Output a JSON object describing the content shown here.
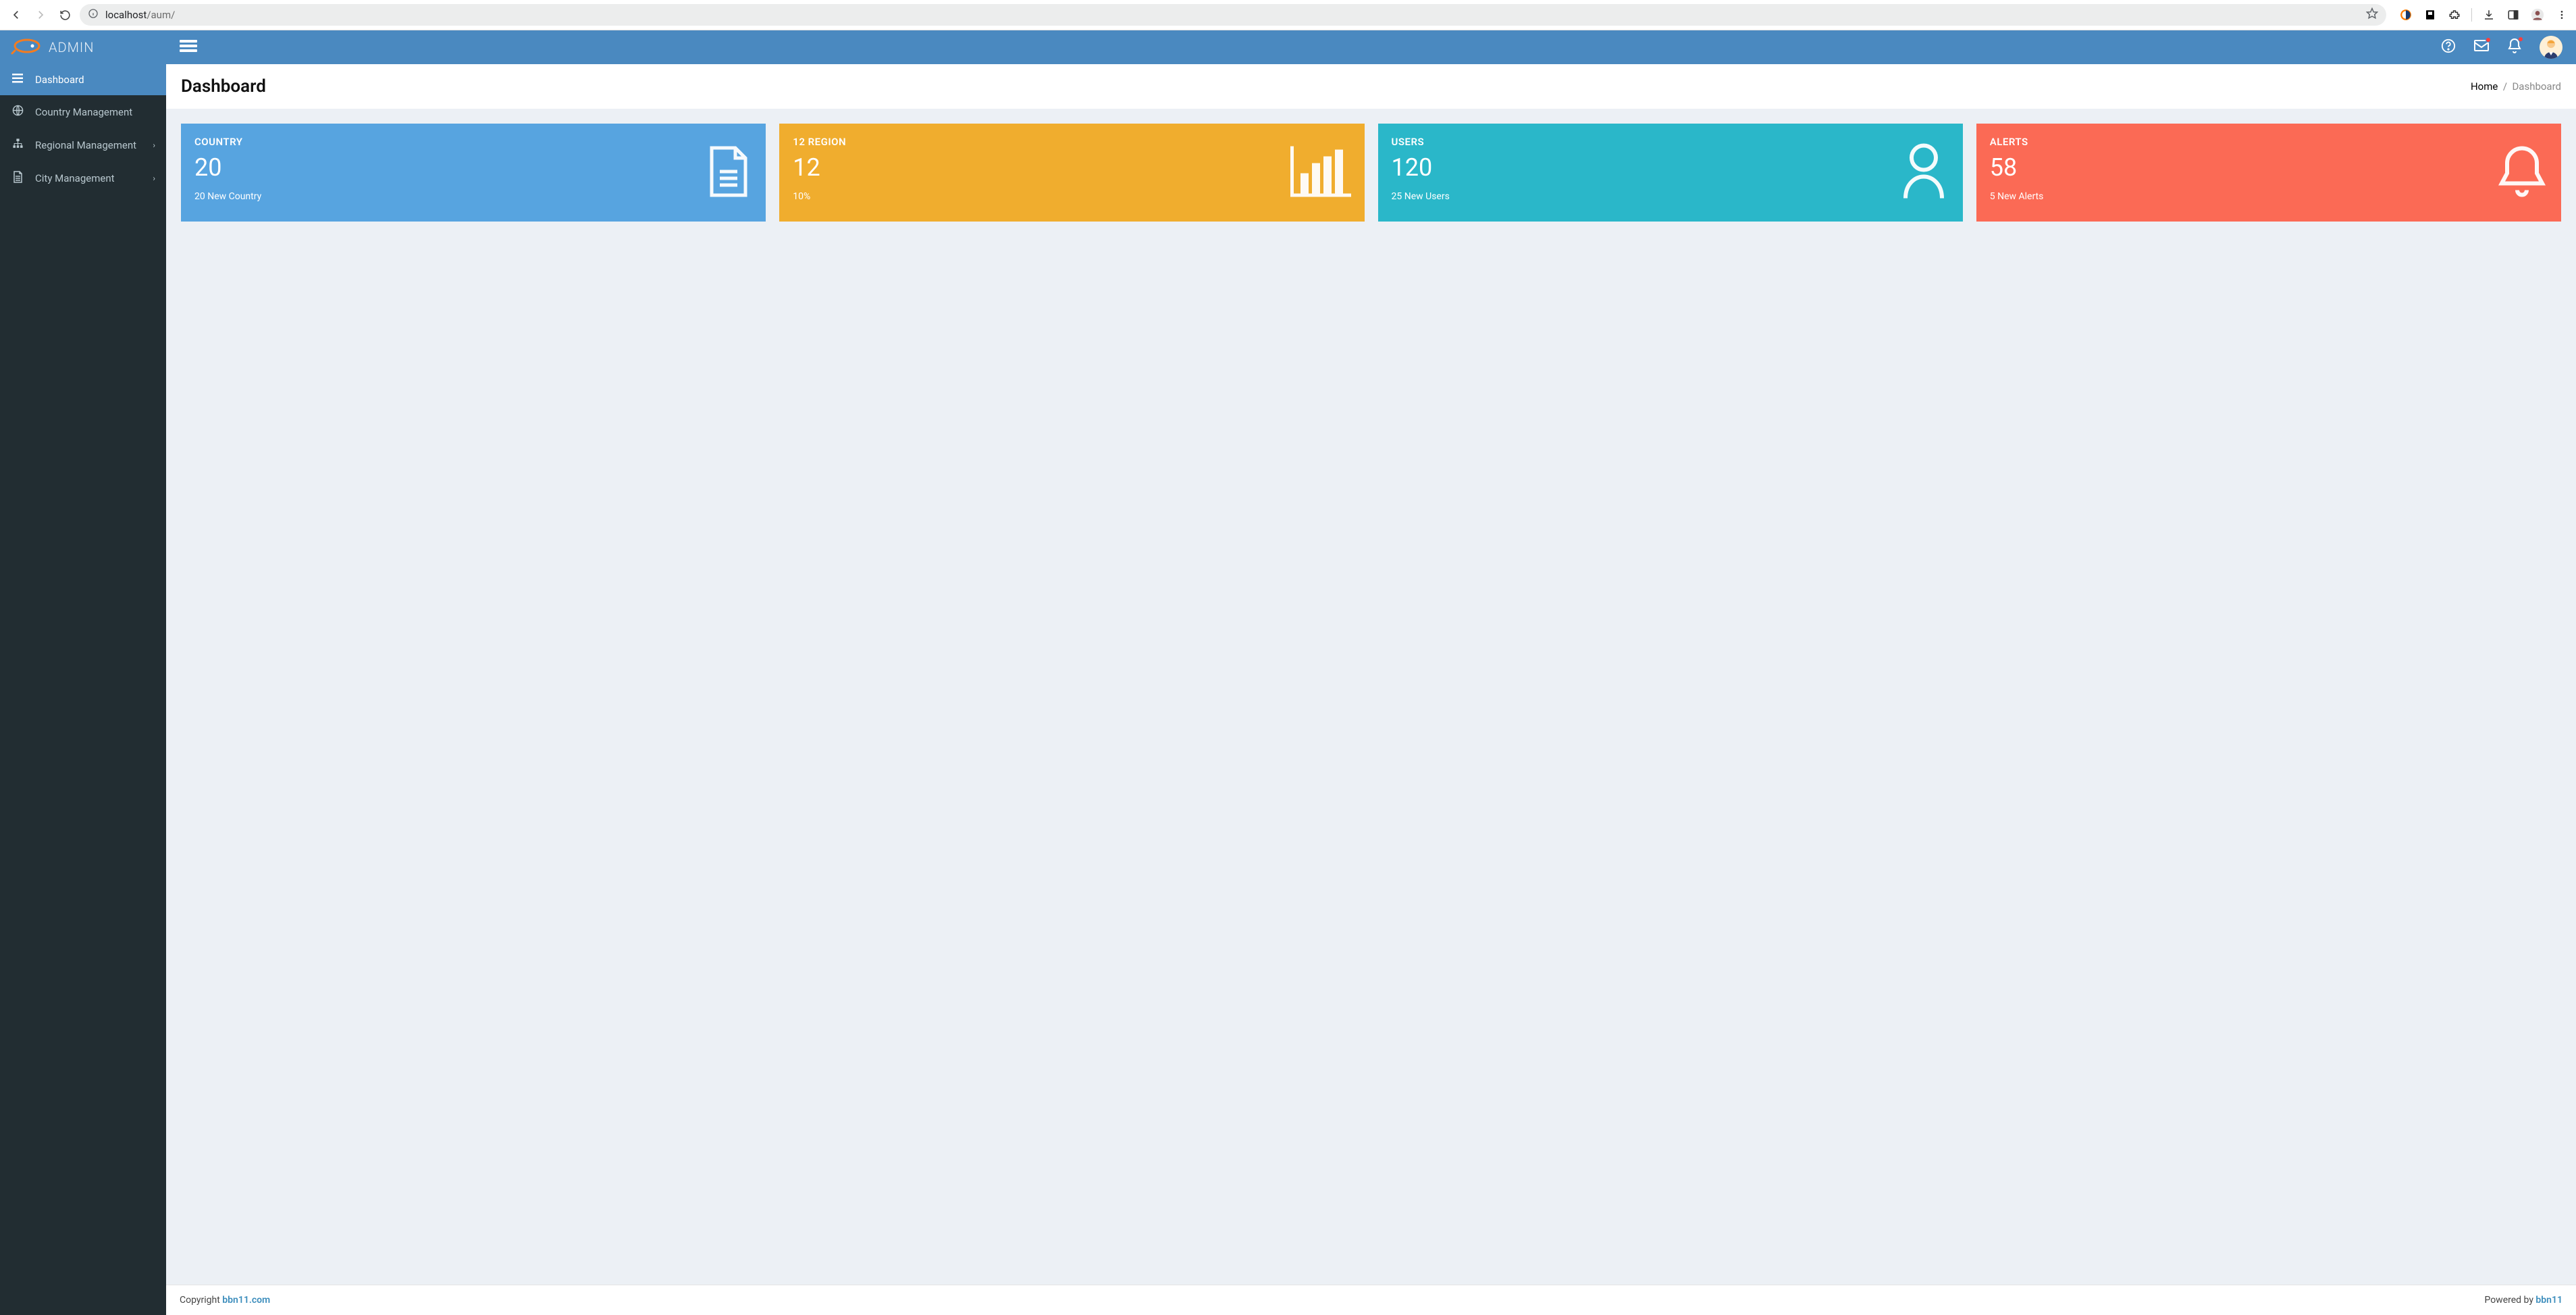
{
  "browser": {
    "url_host": "localhost",
    "url_path": "/aum/"
  },
  "brand": "ADMIN",
  "sidebar": {
    "items": [
      {
        "label": "Dashboard",
        "active": true
      },
      {
        "label": "Country Management",
        "active": false
      },
      {
        "label": "Regional Management",
        "active": false,
        "expandable": true
      },
      {
        "label": "City Management",
        "active": false,
        "expandable": true
      }
    ]
  },
  "page": {
    "title": "Dashboard",
    "breadcrumb_home": "Home",
    "breadcrumb_current": "Dashboard"
  },
  "cards": [
    {
      "title": "COUNTRY",
      "value": "20",
      "sub": "20 New Country",
      "color": "blue",
      "icon": "file"
    },
    {
      "title": "12 REGION",
      "value": "12",
      "sub": "10%",
      "color": "orange",
      "icon": "chart"
    },
    {
      "title": "USERS",
      "value": "120",
      "sub": "25 New Users",
      "color": "teal",
      "icon": "user"
    },
    {
      "title": "ALERTS",
      "value": "58",
      "sub": "5 New Alerts",
      "color": "red",
      "icon": "bell"
    }
  ],
  "footer": {
    "copyright_prefix": "Copyright ",
    "copyright_link": "bbn11.com",
    "powered_prefix": "Powered by ",
    "powered_link": "bbn11"
  }
}
